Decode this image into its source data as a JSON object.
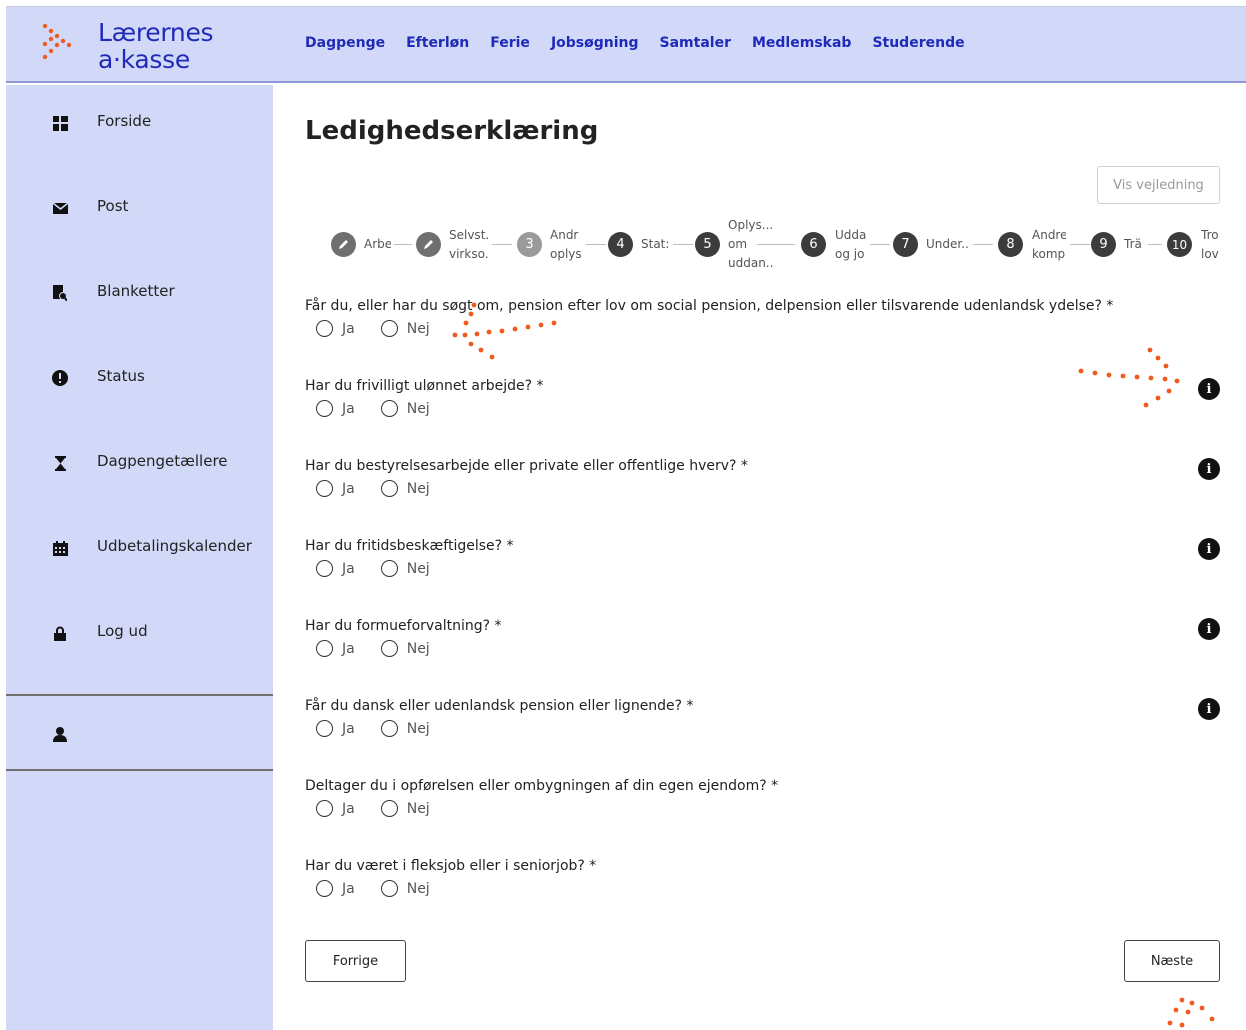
{
  "brand": {
    "line1": "Lærernes",
    "line2": "a·kasse",
    "accent": "#f05a1e",
    "primary": "#1f2bb8"
  },
  "nav": [
    "Dagpenge",
    "Efterløn",
    "Ferie",
    "Jobsøgning",
    "Samtaler",
    "Medlemskab",
    "Studerende"
  ],
  "sidebar": {
    "items": [
      {
        "label": "Forside",
        "icon": "dashboard-icon"
      },
      {
        "label": "Post",
        "icon": "envelope-icon"
      },
      {
        "label": "Blanketter",
        "icon": "form-icon"
      },
      {
        "label": "Status",
        "icon": "alert-circle-icon"
      },
      {
        "label": "Dagpengetællere",
        "icon": "hourglass-icon"
      },
      {
        "label": "Udbetalingskalender",
        "icon": "calendar-icon"
      },
      {
        "label": "Log ud",
        "icon": "lock-icon"
      }
    ],
    "profile_icon": "user-icon"
  },
  "page": {
    "title": "Ledighedserklæring",
    "guide_button": "Vis vejledning"
  },
  "steps": [
    {
      "num": "",
      "state": "done",
      "label1": "Arbe",
      "label2": ""
    },
    {
      "num": "",
      "state": "done",
      "label1": "Selvst.",
      "label2": "virkso."
    },
    {
      "num": "3",
      "state": "todo",
      "label1": "Andr",
      "label2": "oplys"
    },
    {
      "num": "4",
      "state": "current",
      "label1": "Stat:",
      "label2": ""
    },
    {
      "num": "5",
      "state": "todo",
      "label1": "Oplys...",
      "label2": "om",
      "label3": "uddan.."
    },
    {
      "num": "6",
      "state": "todo",
      "label1": "Udda",
      "label2": "og jo"
    },
    {
      "num": "7",
      "state": "todo",
      "label1": "Under..",
      "label2": ""
    },
    {
      "num": "8",
      "state": "todo",
      "label1": "Andre",
      "label2": "komp"
    },
    {
      "num": "9",
      "state": "todo",
      "label1": "Trä",
      "label2": ""
    },
    {
      "num": "10",
      "state": "todo",
      "label1": "Tro",
      "label2": "lov"
    }
  ],
  "questions": [
    {
      "text": "Får du, eller har du søgt om, pension efter lov om social pension, delpension eller tilsvarende udenlandsk ydelse? *",
      "info": false
    },
    {
      "text": "Har du frivilligt ulønnet arbejde? *",
      "info": true
    },
    {
      "text": "Har du bestyrelsesarbejde eller private eller offentlige hverv? *",
      "info": true
    },
    {
      "text": "Har du fritidsbeskæftigelse? *",
      "info": true
    },
    {
      "text": "Har du formueforvaltning? *",
      "info": true
    },
    {
      "text": "Får du dansk eller udenlandsk pension eller lignende? *",
      "info": true
    },
    {
      "text": "Deltager du i opførelsen eller ombygningen af din egen ejendom? *",
      "info": false
    },
    {
      "text": "Har du været i fleksjob eller i seniorjob? *",
      "info": false
    }
  ],
  "options": {
    "yes": "Ja",
    "no": "Nej"
  },
  "buttons": {
    "prev": "Forrige",
    "next": "Næste"
  }
}
